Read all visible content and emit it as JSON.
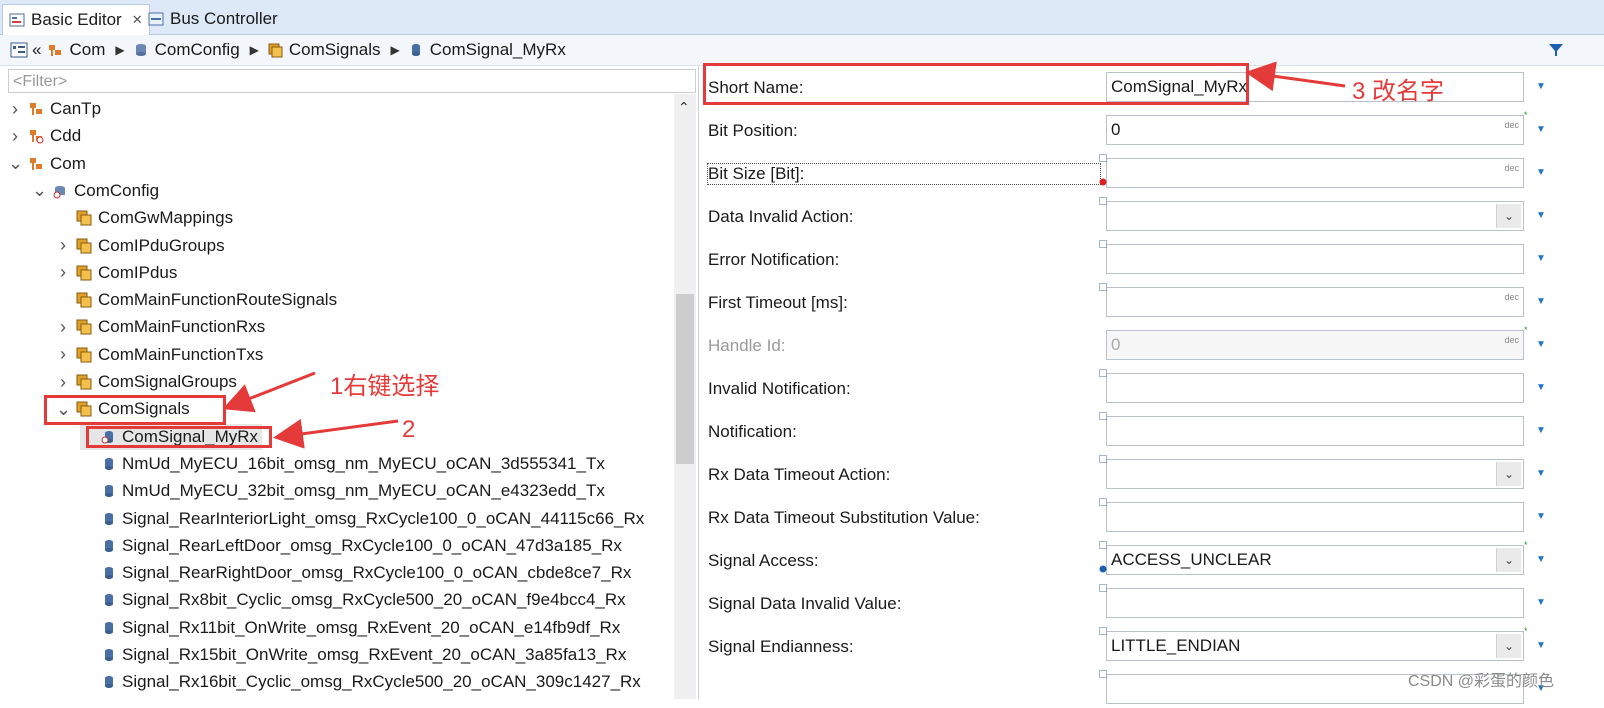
{
  "tabs": {
    "active": {
      "label": "Basic Editor",
      "close": "✕"
    },
    "inactive": {
      "label": "Bus Controller"
    }
  },
  "breadcrumb": {
    "back": "«",
    "items": [
      "Com",
      "ComConfig",
      "ComSignals",
      "ComSignal_MyRx"
    ]
  },
  "tree": {
    "filter_placeholder": "<Filter>",
    "nodes": [
      {
        "label": "CanTp",
        "arrow": ">"
      },
      {
        "label": "Cdd",
        "arrow": ">"
      },
      {
        "label": "Com",
        "arrow": "v"
      },
      {
        "label": "ComConfig",
        "arrow": "v"
      },
      {
        "label": "ComGwMappings",
        "arrow": ""
      },
      {
        "label": "ComIPduGroups",
        "arrow": ">"
      },
      {
        "label": "ComIPdus",
        "arrow": ">"
      },
      {
        "label": "ComMainFunctionRouteSignals",
        "arrow": ""
      },
      {
        "label": "ComMainFunctionRxs",
        "arrow": ">"
      },
      {
        "label": "ComMainFunctionTxs",
        "arrow": ">"
      },
      {
        "label": "ComSignalGroups",
        "arrow": ">"
      },
      {
        "label": "ComSignals",
        "arrow": "v"
      },
      {
        "label": "ComSignal_MyRx",
        "arrow": ""
      },
      {
        "label": "NmUd_MyECU_16bit_omsg_nm_MyECU_oCAN_3d555341_Tx",
        "arrow": ""
      },
      {
        "label": "NmUd_MyECU_32bit_omsg_nm_MyECU_oCAN_e4323edd_Tx",
        "arrow": ""
      },
      {
        "label": "Signal_RearInteriorLight_omsg_RxCycle100_0_oCAN_44115c66_Rx",
        "arrow": ""
      },
      {
        "label": "Signal_RearLeftDoor_omsg_RxCycle100_0_oCAN_47d3a185_Rx",
        "arrow": ""
      },
      {
        "label": "Signal_RearRightDoor_omsg_RxCycle100_0_oCAN_cbde8ce7_Rx",
        "arrow": ""
      },
      {
        "label": "Signal_Rx8bit_Cyclic_omsg_RxCycle500_20_oCAN_f9e4bcc4_Rx",
        "arrow": ""
      },
      {
        "label": "Signal_Rx11bit_OnWrite_omsg_RxEvent_20_oCAN_e14fb9df_Rx",
        "arrow": ""
      },
      {
        "label": "Signal_Rx15bit_OnWrite_omsg_RxEvent_20_oCAN_3a85fa13_Rx",
        "arrow": ""
      },
      {
        "label": "Signal_Rx16bit_Cyclic_omsg_RxCycle500_20_oCAN_309c1427_Rx",
        "arrow": ""
      }
    ]
  },
  "properties": [
    {
      "label": "Short Name:",
      "value": "ComSignal_MyRx",
      "kind": "text"
    },
    {
      "label": "Bit Position:",
      "value": "0",
      "kind": "dec"
    },
    {
      "label": "Bit Size [Bit]:",
      "value": "",
      "kind": "dec"
    },
    {
      "label": "Data Invalid Action:",
      "value": "",
      "kind": "combo"
    },
    {
      "label": "Error Notification:",
      "value": "",
      "kind": "text"
    },
    {
      "label": "First Timeout [ms]:",
      "value": "",
      "kind": "dec"
    },
    {
      "label": "Handle Id:",
      "value": "0",
      "kind": "dec-disabled"
    },
    {
      "label": "Invalid Notification:",
      "value": "",
      "kind": "text"
    },
    {
      "label": "Notification:",
      "value": "",
      "kind": "text"
    },
    {
      "label": "Rx Data Timeout Action:",
      "value": "",
      "kind": "combo"
    },
    {
      "label": "Rx Data Timeout Substitution Value:",
      "value": "",
      "kind": "text"
    },
    {
      "label": "Signal Access:",
      "value": "ACCESS_UNCLEAR",
      "kind": "combo"
    },
    {
      "label": "Signal Data Invalid Value:",
      "value": "",
      "kind": "text"
    },
    {
      "label": "Signal Endianness:",
      "value": "LITTLE_ENDIAN",
      "kind": "combo"
    },
    {
      "label": "",
      "value": "",
      "kind": "text"
    }
  ],
  "dec_tag": "dec",
  "annotations": {
    "step1": "1右键选择",
    "step2": "2",
    "step3": "3 改名字"
  },
  "watermark": "CSDN @彩蛋的颜色",
  "colors": {
    "annotation": "#e53a3a",
    "tab_bar": "#dde9f7",
    "dropdown_arrow": "#1e73c6"
  }
}
